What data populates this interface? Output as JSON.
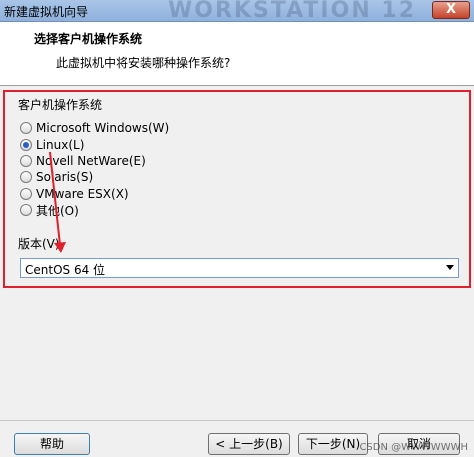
{
  "window": {
    "title": "新建虚拟机向导",
    "watermark": "WORKSTATION 12",
    "close_label": "X"
  },
  "header": {
    "heading": "选择客户机操作系统",
    "subheading": "此虚拟机中将安装哪种操作系统?"
  },
  "guest_os": {
    "group_label": "客户机操作系统",
    "options": [
      {
        "label": "Microsoft Windows(W)",
        "checked": false
      },
      {
        "label": "Linux(L)",
        "checked": true
      },
      {
        "label": "Novell NetWare(E)",
        "checked": false
      },
      {
        "label": "Solaris(S)",
        "checked": false
      },
      {
        "label": "VMware ESX(X)",
        "checked": false
      },
      {
        "label": "其他(O)",
        "checked": false
      }
    ]
  },
  "version": {
    "label": "版本(V)",
    "selected": "CentOS 64 位"
  },
  "footer": {
    "help_label": "帮助",
    "back_label": "< 上一步(B)",
    "next_label": "下一步(N) >",
    "cancel_label": "取消",
    "watermark": "CSDN @WWWWWWH"
  },
  "colors": {
    "highlight": "#e0202a",
    "radio_checked": "#2a5fc8"
  }
}
